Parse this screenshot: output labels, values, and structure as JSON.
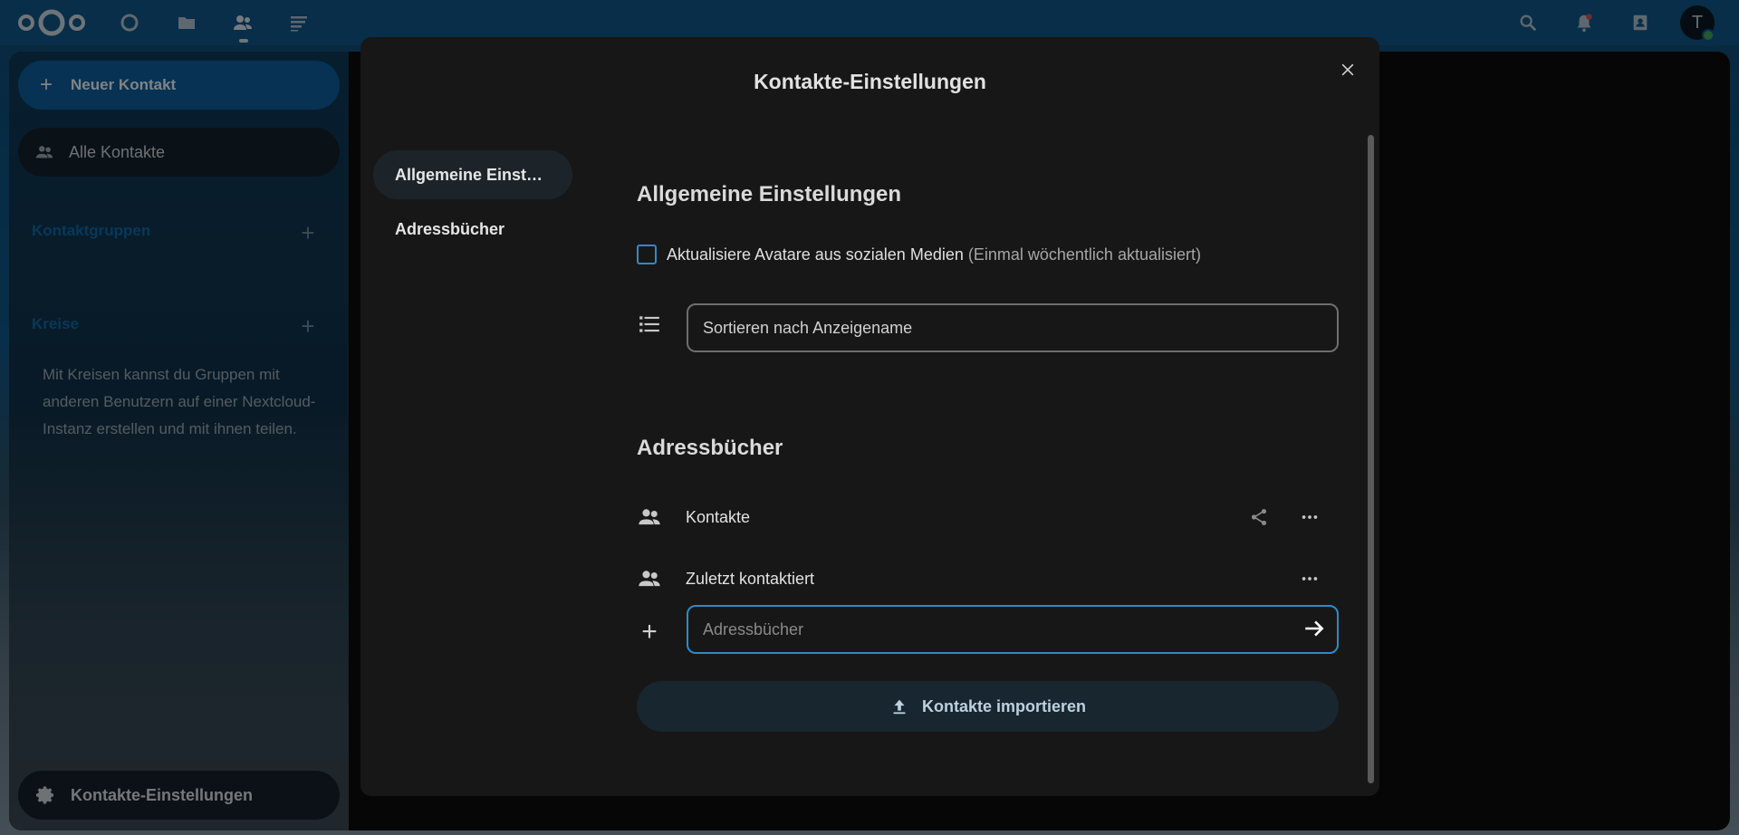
{
  "header": {
    "apps": [
      "dashboard-icon",
      "files-icon",
      "contacts-icon",
      "activity-icon"
    ],
    "right_icons": [
      "search-icon",
      "notifications-icon",
      "contacts-menu-icon"
    ],
    "avatar_initial": "T"
  },
  "sidebar": {
    "new_contact_label": "Neuer Kontakt",
    "all_contacts_label": "Alle Kontakte",
    "groups_heading": "Kontaktgruppen",
    "circles_heading": "Kreise",
    "circles_text": "Mit Kreisen kannst du Gruppen mit anderen Benutzern auf einer Nextcloud-Instanz erstellen und mit ihnen teilen.",
    "settings_label": "Kontakte-Einstellungen"
  },
  "modal": {
    "title": "Kontakte-Einstellungen",
    "nav": [
      {
        "label": "Allgemeine Einst…",
        "active": true
      },
      {
        "label": "Adressbücher",
        "active": false
      }
    ],
    "general": {
      "heading": "Allgemeine Einstellungen",
      "checkbox_label": "Aktualisiere Avatare aus sozialen Medien",
      "checkbox_hint": "(Einmal wöchentlich aktualisiert)",
      "checkbox_checked": false,
      "sort_value": "Sortieren nach Anzeigename"
    },
    "addressbooks": {
      "heading": "Adressbücher",
      "items": [
        {
          "name": "Kontakte",
          "shareable": true
        },
        {
          "name": "Zuletzt kontaktiert",
          "shareable": false
        }
      ],
      "new_placeholder": "Adressbücher",
      "import_label": "Kontakte importieren"
    }
  },
  "colors": {
    "accent": "#2f8ac9",
    "header_bg": "#0f5586",
    "modal_bg": "#171717"
  }
}
